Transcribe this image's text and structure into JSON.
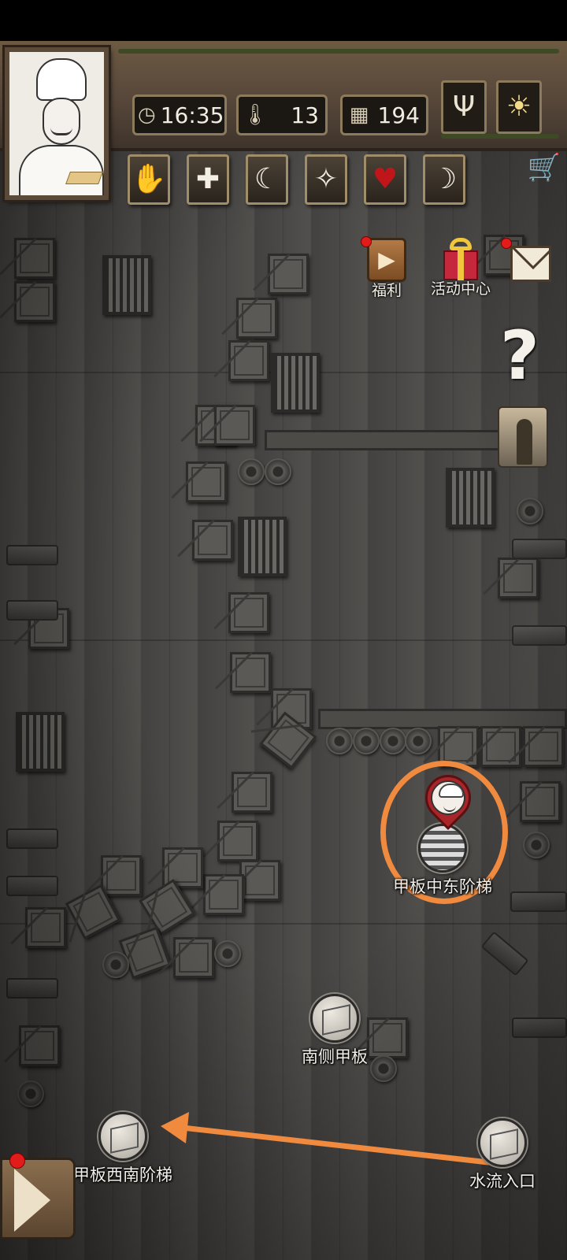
{
  "hud": {
    "time": "16:35",
    "temperature": "13",
    "day": "194",
    "icons": {
      "clock": "clock-icon",
      "thermometer": "thermometer-icon",
      "calendar": "calendar-icon",
      "sprout": "sprout-icon",
      "weather": "sun-icon",
      "cart": "shopping-cart-icon"
    },
    "status_icons": [
      "bandaged-hand-icon",
      "health-cross-icon",
      "stomach-icon",
      "sanity-head-icon",
      "heart-icon",
      "moon-sleep-icon"
    ]
  },
  "side_menu": {
    "welfare_label": "福利",
    "events_label": "活动中心"
  },
  "map_nodes": {
    "current": "甲板中东阶梯",
    "south_deck": "南侧甲板",
    "southwest_stairs": "甲板西南阶梯",
    "water_inlet": "水流入口"
  },
  "colors": {
    "highlight": "#f08a3e",
    "badge": "#e21b1b",
    "pin": "#a8262a"
  }
}
